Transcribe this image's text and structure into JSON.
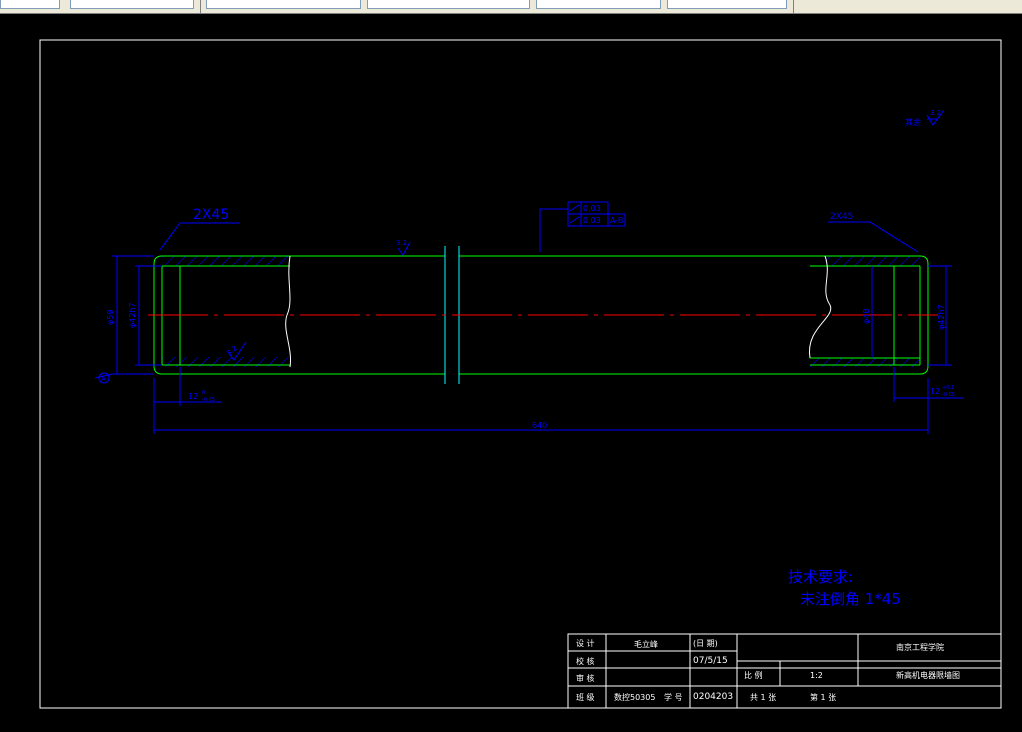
{
  "toolbar": {
    "fields": [
      "",
      "",
      "",
      "",
      "",
      "",
      ""
    ]
  },
  "drawing": {
    "chamfer_left": "2X45",
    "chamfer_right": "2X45",
    "roughness_mid": "3.2",
    "roughness_corner": "3.2",
    "roughness_corner_label": "其余",
    "gdt": {
      "row1_tol": "0.03",
      "row2_tol": "0.03",
      "row2_datum": "A-B"
    },
    "dim_left_outer": "φ59",
    "dim_left_inner": "φ42h7",
    "dim_left_datum": "A",
    "dim_right_outer": "φ42h7",
    "dim_right_inner": "φ48",
    "dim_left_length": "12",
    "dim_left_length_tol_upper": "0",
    "dim_left_length_tol_lower": "-0.05",
    "dim_right_length": "12",
    "dim_right_length_tol_upper": "+0.1",
    "dim_right_length_tol_lower": "-0.05",
    "dim_total": "640",
    "tech_title": "技术要求:",
    "tech_line1": "未注倒角 1*45"
  },
  "title_block": {
    "designer_label": "设 计",
    "designer_name": "毛立峰",
    "date_label": "(日  期)",
    "date_value": "07/5/15",
    "checker_label": "校 核",
    "reviewer_label": "审 核",
    "class_label": "班 级",
    "class_value": "数控50305",
    "student_no_label": "学 号",
    "student_no_value": "0204203",
    "school": "南京工程学院",
    "scale_label": "比 例",
    "scale_value": "1:2",
    "part_name": "新高机电器限墙图",
    "sheets_total": "共 1 张",
    "sheet_no": "第 1 张"
  }
}
